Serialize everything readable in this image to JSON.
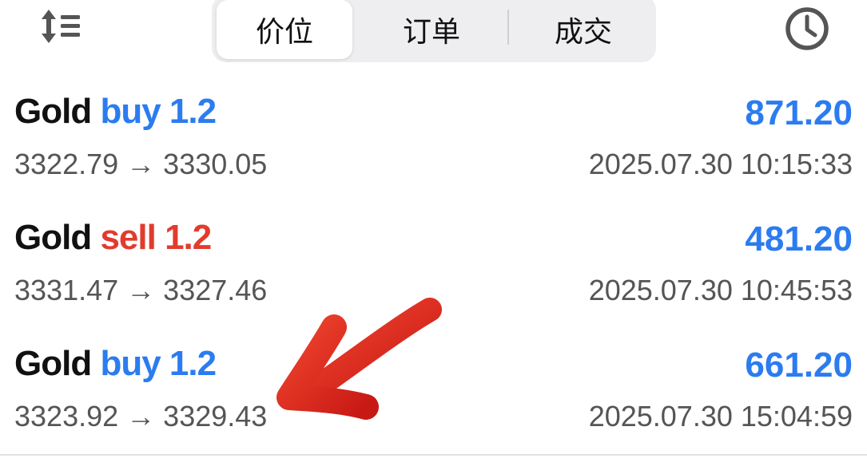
{
  "toolbar": {
    "sort_icon": "sort-list-icon",
    "tabs": [
      {
        "label": "价位",
        "active": true
      },
      {
        "label": "订单",
        "active": false
      },
      {
        "label": "成交",
        "active": false
      }
    ],
    "history_icon": "clock-icon"
  },
  "deals": [
    {
      "symbol": "Gold",
      "type": "buy",
      "volume": "1.2",
      "open_price": "3322.79",
      "arrow": "→",
      "close_price": "3330.05",
      "profit": "871.20",
      "time": "2025.07.30 10:15:33"
    },
    {
      "symbol": "Gold",
      "type": "sell",
      "volume": "1.2",
      "open_price": "3331.47",
      "arrow": "→",
      "close_price": "3327.46",
      "profit": "481.20",
      "time": "2025.07.30 10:45:53"
    },
    {
      "symbol": "Gold",
      "type": "buy",
      "volume": "1.2",
      "open_price": "3323.92",
      "arrow": "→",
      "close_price": "3329.43",
      "profit": "661.20",
      "time": "2025.07.30 15:04:59"
    }
  ],
  "colors": {
    "buy": "#2b7cf0",
    "sell": "#e23b2e",
    "profit": "#2b7cf0",
    "annotation_arrow": "#d8231c"
  },
  "annotation": "red-arrow-pointing-at-third-deal"
}
